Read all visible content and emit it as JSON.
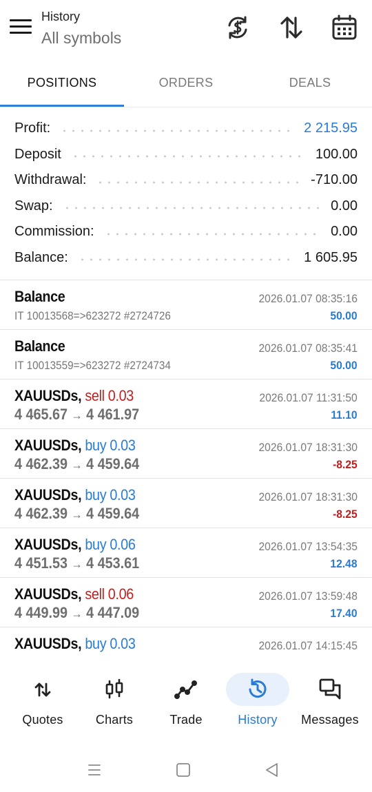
{
  "header": {
    "title": "History",
    "subtitle": "All symbols",
    "icons": [
      "menu-icon",
      "currency-exchange-icon",
      "sort-icon",
      "calendar-icon"
    ]
  },
  "tabs": [
    {
      "label": "POSITIONS",
      "active": true
    },
    {
      "label": "ORDERS",
      "active": false
    },
    {
      "label": "DEALS",
      "active": false
    }
  ],
  "summary": [
    {
      "label": "Profit:",
      "value": "2 215.95",
      "color": "#2a7bd4"
    },
    {
      "label": "Deposit",
      "value": "100.00"
    },
    {
      "label": "Withdrawal:",
      "value": "-710.00"
    },
    {
      "label": "Swap:",
      "value": "0.00"
    },
    {
      "label": "Commission:",
      "value": "0.00"
    },
    {
      "label": "Balance:",
      "value": "1 605.95"
    }
  ],
  "entries": [
    {
      "type": "balance",
      "title": "Balance",
      "comment": "IT 10013568=>623272 #2724726",
      "time": "2026.01.07 08:35:16",
      "profit": "50.00",
      "sign": "pos"
    },
    {
      "type": "balance",
      "title": "Balance",
      "comment": "IT 10013559=>623272 #2724734",
      "time": "2026.01.07 08:35:41",
      "profit": "50.00",
      "sign": "pos"
    },
    {
      "type": "trade",
      "symbol": "XAUUSDs,",
      "side": "sell 0.03",
      "side_class": "sell",
      "open": "4 465.67",
      "close": "4 461.97",
      "arrow": "→",
      "time": "2026.01.07 11:31:50",
      "profit": "11.10",
      "sign": "pos"
    },
    {
      "type": "trade",
      "symbol": "XAUUSDs,",
      "side": "buy 0.03",
      "side_class": "buy",
      "open": "4 462.39",
      "close": "4 459.64",
      "arrow": "→",
      "time": "2026.01.07 18:31:30",
      "profit": "-8.25",
      "sign": "neg"
    },
    {
      "type": "trade",
      "symbol": "XAUUSDs,",
      "side": "buy 0.03",
      "side_class": "buy",
      "open": "4 462.39",
      "close": "4 459.64",
      "arrow": "→",
      "time": "2026.01.07 18:31:30",
      "profit": "-8.25",
      "sign": "neg"
    },
    {
      "type": "trade",
      "symbol": "XAUUSDs,",
      "side": "buy 0.06",
      "side_class": "buy",
      "open": "4 451.53",
      "close": "4 453.61",
      "arrow": "→",
      "time": "2026.01.07 13:54:35",
      "profit": "12.48",
      "sign": "pos"
    },
    {
      "type": "trade",
      "symbol": "XAUUSDs,",
      "side": "sell 0.06",
      "side_class": "sell",
      "open": "4 449.99",
      "close": "4 447.09",
      "arrow": "→",
      "time": "2026.01.07 13:59:48",
      "profit": "17.40",
      "sign": "pos"
    },
    {
      "type": "trade",
      "symbol": "XAUUSDs,",
      "side": "buy 0.03",
      "side_class": "buy",
      "time": "2026.01.07 14:15:45"
    }
  ],
  "bottom_nav": [
    {
      "label": "Quotes",
      "icon": "quotes-icon",
      "active": false
    },
    {
      "label": "Charts",
      "icon": "candlestick-chart-icon",
      "active": false
    },
    {
      "label": "Trade",
      "icon": "trade-line-icon",
      "active": false
    },
    {
      "label": "History",
      "icon": "history-icon",
      "active": true
    },
    {
      "label": "Messages",
      "icon": "messages-icon",
      "active": false
    }
  ],
  "system_nav": [
    "recent-apps-icon",
    "home-icon",
    "back-icon"
  ],
  "colors": {
    "accent": "#2a7bd4",
    "negative": "#c51d1d",
    "tab_indicator": "#2f7ed8",
    "active_nav_bg": "#e7f0fb"
  }
}
